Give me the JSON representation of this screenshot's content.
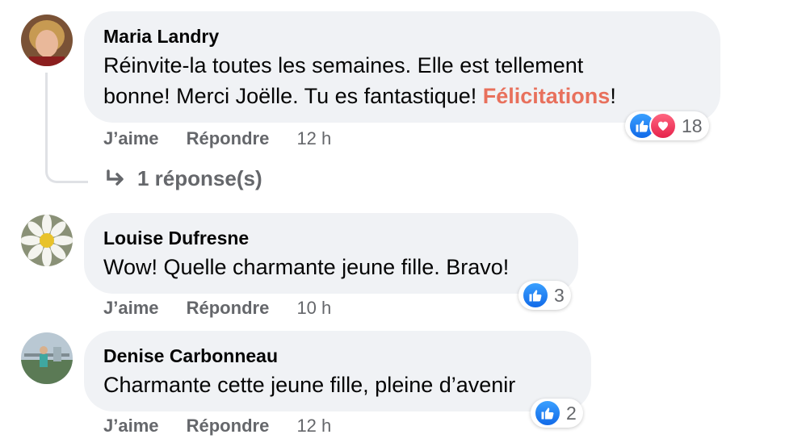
{
  "comments": [
    {
      "author": "Maria Landry",
      "text_line1": "Réinvite-la toutes les semaines. Elle est tellement",
      "text_line2_before": "bonne! Merci Joëlle. Tu es fantastique! ",
      "mention": "Félicitations",
      "text_line2_after": "!",
      "like_label": "J’aime",
      "reply_label": "Répondre",
      "time": "12 h",
      "reactions": [
        "like",
        "love"
      ],
      "reaction_count": "18",
      "replies_label": "1 réponse(s)"
    },
    {
      "author": "Louise Dufresne",
      "text": "Wow! Quelle charmante jeune fille. Bravo!",
      "like_label": "J’aime",
      "reply_label": "Répondre",
      "time": "10 h",
      "reactions": [
        "like"
      ],
      "reaction_count": "3"
    },
    {
      "author": "Denise Carbonneau",
      "text": "Charmante cette jeune fille, pleine d’avenir",
      "like_label": "J’aime",
      "reply_label": "Répondre",
      "time": "12 h",
      "reactions": [
        "like"
      ],
      "reaction_count": "2"
    }
  ],
  "colors": {
    "bubble": "#f0f2f5",
    "mention": "#e8705c",
    "meta": "#65676b",
    "like": "#1877f2",
    "love": "#f33e58"
  },
  "icons": {
    "like": "thumbs-up-icon",
    "love": "heart-icon",
    "reply_arrow": "reply-arrow-icon"
  }
}
